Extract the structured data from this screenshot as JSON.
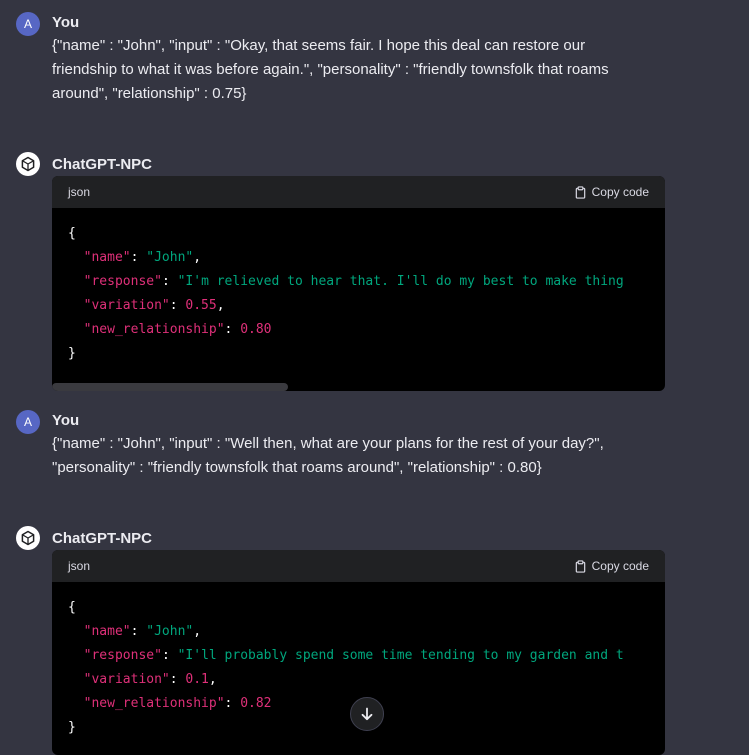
{
  "messages": [
    {
      "role": "user",
      "avatar_letter": "A",
      "author": "You",
      "text": "{\"name\" : \"John\",  \"input\" : \"Okay, that seems fair. I hope this deal can restore our friendship to what it was before again.\", \"personality\" : \"friendly townsfolk that roams around\", \"relationship\" : 0.75}"
    },
    {
      "role": "assistant",
      "author": "ChatGPT-NPC",
      "code_lang": "json",
      "copy_label": "Copy code",
      "code": {
        "open": "{",
        "close": "}",
        "lines": [
          {
            "key": "\"name\"",
            "value": "\"John\"",
            "type": "string",
            "comma": ","
          },
          {
            "key": "\"response\"",
            "value": "\"I'm relieved to hear that. I'll do my best to make thing",
            "type": "string",
            "comma": ""
          },
          {
            "key": "\"variation\"",
            "value": "0.55",
            "type": "number",
            "comma": ","
          },
          {
            "key": "\"new_relationship\"",
            "value": "0.80",
            "type": "number",
            "comma": ""
          }
        ]
      }
    },
    {
      "role": "user",
      "avatar_letter": "A",
      "author": "You",
      "text": "{\"name\" : \"John\",  \"input\" : \"Well then, what are your plans for the rest of your day?\", \"personality\" : \"friendly townsfolk that roams around\", \"relationship\" : 0.80}"
    },
    {
      "role": "assistant",
      "author": "ChatGPT-NPC",
      "code_lang": "json",
      "copy_label": "Copy code",
      "code": {
        "open": "{",
        "close": "}",
        "lines": [
          {
            "key": "\"name\"",
            "value": "\"John\"",
            "type": "string",
            "comma": ","
          },
          {
            "key": "\"response\"",
            "value": "\"I'll probably spend some time tending to my garden and t",
            "type": "string",
            "comma": ""
          },
          {
            "key": "\"variation\"",
            "value": "0.1",
            "type": "number",
            "comma": ","
          },
          {
            "key": "\"new_relationship\"",
            "value": "0.82",
            "type": "number",
            "comma": ""
          }
        ]
      }
    }
  ],
  "icons": {
    "bot_avatar": "openai-logo-icon",
    "copy": "clipboard-icon",
    "scroll": "arrow-down-icon"
  },
  "colors": {
    "background": "#343541",
    "code_bg": "#000000",
    "code_header_bg": "#202123",
    "user_avatar": "#5767c4",
    "json_key": "#df3079",
    "json_string": "#00a67d",
    "json_number": "#df3079"
  }
}
